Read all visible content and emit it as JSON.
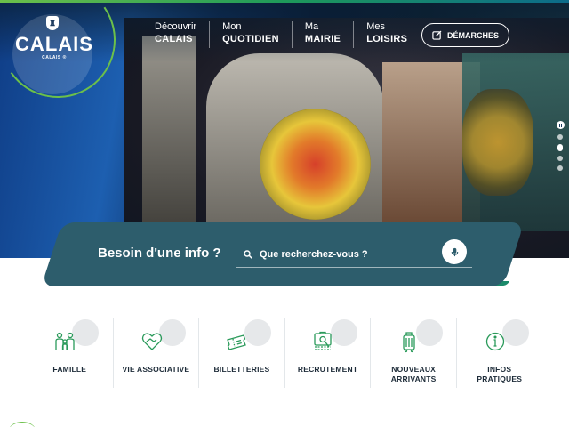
{
  "header": {
    "logo": {
      "name": "CALAIS",
      "tagline": "CALAIS ®"
    },
    "nav": [
      {
        "small": "Découvrir",
        "big": "CALAIS"
      },
      {
        "small": "Mon",
        "big": "QUOTIDIEN"
      },
      {
        "small": "Ma",
        "big": "MAIRIE"
      },
      {
        "small": "Mes",
        "big": "LOISIRS"
      }
    ],
    "demarches_label": "DÉMARCHES"
  },
  "search": {
    "title": "Besoin d'une info ?",
    "placeholder": "Que recherchez-vous ?"
  },
  "quicklinks": [
    {
      "label": "FAMILLE",
      "icon": "family-icon"
    },
    {
      "label": "VIE ASSOCIATIVE",
      "icon": "handshake-heart-icon"
    },
    {
      "label": "BILLETTERIES",
      "icon": "ticket-icon"
    },
    {
      "label": "RECRUTEMENT",
      "icon": "briefcase-search-icon"
    },
    {
      "label": "NOUVEAUX ARRIVANTS",
      "label_lines": [
        "NOUVEAUX",
        "ARRIVANTS"
      ],
      "icon": "suitcase-icon"
    },
    {
      "label": "INFOS PRATIQUES",
      "label_lines": [
        "INFOS",
        "PRATIQUES"
      ],
      "icon": "info-icon"
    }
  ],
  "slider": {
    "slides": 4,
    "active": 2
  },
  "colors": {
    "accent_green": "#6cc04a",
    "icon_green": "#2a9a5a",
    "search_band": "#2d5d6c",
    "text_dark": "#1d2b38"
  }
}
